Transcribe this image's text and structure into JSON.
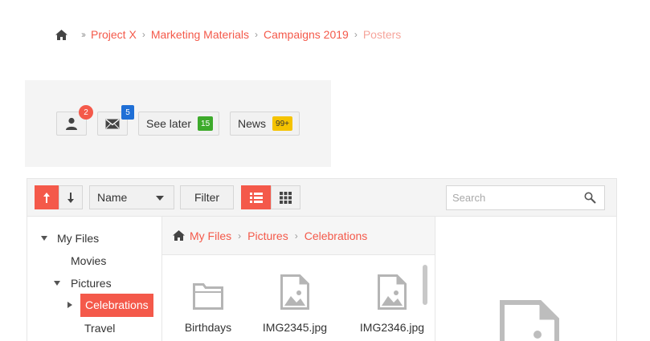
{
  "breadcrumb": {
    "items": [
      "Project X",
      "Marketing Materials",
      "Campaigns 2019"
    ],
    "current": "Posters"
  },
  "badges": {
    "user_count": "2",
    "mail_count": "5",
    "see_later_label": "See later",
    "see_later_count": "15",
    "news_label": "News",
    "news_count": "99+"
  },
  "toolbar": {
    "sort_value": "Name",
    "filter_label": "Filter",
    "search_placeholder": "Search"
  },
  "tree": {
    "my_files": "My Files",
    "movies": "Movies",
    "pictures": "Pictures",
    "celebrations": "Celebrations",
    "travel": "Travel"
  },
  "content": {
    "path": [
      "My Files",
      "Pictures",
      "Celebrations"
    ],
    "files": [
      {
        "name": "Birthdays",
        "type": "folder"
      },
      {
        "name": "IMG2345.jpg",
        "type": "image"
      },
      {
        "name": "IMG2346.jpg",
        "type": "image"
      }
    ]
  },
  "colors": {
    "accent": "#f4594a",
    "blue_badge": "#1f6fd6",
    "green_badge": "#3daa2b",
    "yellow_badge": "#f5c300"
  }
}
